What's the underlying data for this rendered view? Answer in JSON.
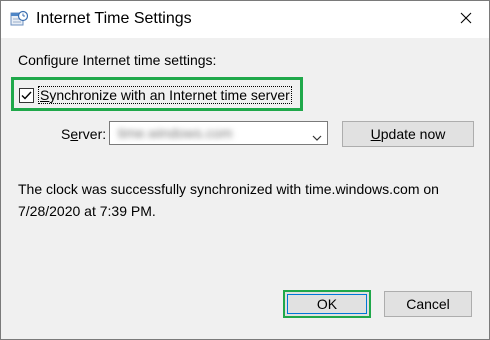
{
  "window": {
    "title": "Internet Time Settings",
    "icon": "date-time-settings-icon",
    "close_icon": "close-icon"
  },
  "main": {
    "configure_label": "Configure Internet time settings:",
    "sync_checkbox": {
      "checked": true,
      "label_prefix": "",
      "label_mnemonic": "S",
      "label_rest": "ynchronize with an Internet time server"
    },
    "server": {
      "label_mnemonic": "e",
      "label_prefix": "S",
      "label_rest": "rver:",
      "value": "time.windows.com"
    },
    "update_button": {
      "mnemonic": "U",
      "rest": "pdate now"
    },
    "status_message": "The clock was successfully synchronized with time.windows.com on 7/28/2020 at 7:39 PM."
  },
  "buttons": {
    "ok": "OK",
    "cancel": "Cancel"
  },
  "colors": {
    "highlight_green": "#1fa84a",
    "dialog_bg": "#f0f0f0",
    "button_bg": "#e1e1e1",
    "focus_blue": "#0078d7"
  }
}
